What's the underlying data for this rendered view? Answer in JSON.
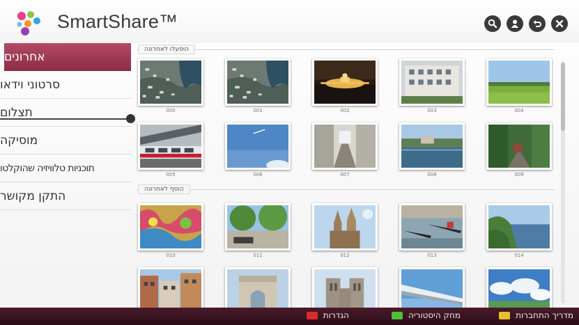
{
  "app": {
    "title": "SmartShare™"
  },
  "header_buttons": [
    {
      "icon": "search-icon",
      "name": "search-button"
    },
    {
      "icon": "user-icon",
      "name": "account-button"
    },
    {
      "icon": "back-icon",
      "name": "back-button"
    },
    {
      "icon": "close-icon",
      "name": "close-button"
    }
  ],
  "sidebar": {
    "items": [
      {
        "label": "אחרונים",
        "active": true
      },
      {
        "label": "סרטוני וידאו"
      },
      {
        "label": "תצלום"
      },
      {
        "label": "מוסיקה"
      },
      {
        "label": "תוכניות טלוויזיה שהוקלטו"
      },
      {
        "label": "התקן מקושר"
      }
    ]
  },
  "sections": {
    "recently_played": "הופעלו לאחרונה",
    "recently_added": "הוסף לאחרונה"
  },
  "row1": [
    {
      "caption": "000",
      "scene": "aerial-city"
    },
    {
      "caption": "001",
      "scene": "aerial-city"
    },
    {
      "caption": "002",
      "scene": "night-palace"
    },
    {
      "caption": "003",
      "scene": "building"
    },
    {
      "caption": "004",
      "scene": "field"
    }
  ],
  "row2": [
    {
      "caption": "005",
      "scene": "train"
    },
    {
      "caption": "006",
      "scene": "sky"
    },
    {
      "caption": "007",
      "scene": "alley"
    },
    {
      "caption": "008",
      "scene": "river"
    },
    {
      "caption": "009",
      "scene": "forest-train"
    }
  ],
  "row3": [
    {
      "caption": "010",
      "scene": "graffiti"
    },
    {
      "caption": "011",
      "scene": "park"
    },
    {
      "caption": "012",
      "scene": "cathedral"
    },
    {
      "caption": "013",
      "scene": "gondolas"
    },
    {
      "caption": "014",
      "scene": "coast"
    }
  ],
  "row4": [
    {
      "caption": "",
      "scene": "street"
    },
    {
      "caption": "",
      "scene": "arch"
    },
    {
      "caption": "",
      "scene": "notre-dame"
    },
    {
      "caption": "",
      "scene": "wing"
    },
    {
      "caption": "",
      "scene": "clouds"
    }
  ],
  "bottom_bar": [
    {
      "label": "מדריך התחברות",
      "color": "#e9c12a"
    },
    {
      "label": "מחק היסטוריה",
      "color": "#4fbf3a"
    },
    {
      "label": "הגדרות",
      "color": "#d92b2b"
    }
  ]
}
